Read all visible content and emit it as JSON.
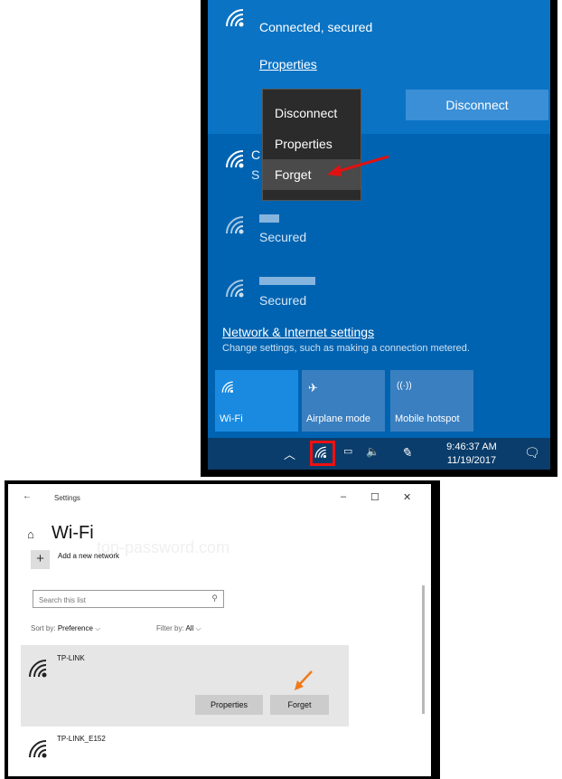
{
  "flyout": {
    "connected_status": "Connected, secured",
    "properties_link": "Properties",
    "disconnect_button": "Disconnect",
    "context_menu": [
      "Disconnect",
      "Properties",
      "Forget"
    ],
    "networks": [
      {
        "name_prefix": "C",
        "status_prefix": "S"
      },
      {
        "status": "Secured"
      },
      {
        "status": "Secured"
      }
    ],
    "network_settings_link": "Network & Internet settings",
    "network_settings_sub": "Change settings, such as making a connection metered.",
    "tiles": [
      {
        "label": "Wi-Fi",
        "icon": "wifi-icon",
        "active": true
      },
      {
        "label": "Airplane mode",
        "icon": "airplane-icon",
        "active": false
      },
      {
        "label": "Mobile hotspot",
        "icon": "hotspot-icon",
        "active": false
      }
    ],
    "taskbar": {
      "time": "9:46:37 AM",
      "date": "11/19/2017"
    },
    "colors": {
      "accent": "#0063b1",
      "highlight_box": "#e11111",
      "arrow": "#e11111"
    }
  },
  "settings": {
    "window_title": "Settings",
    "page_title": "Wi-Fi",
    "add_network": "Add a new network",
    "search_placeholder": "Search this list",
    "sort_label": "Sort by:",
    "sort_value": "Preference",
    "filter_label": "Filter by:",
    "filter_value": "All",
    "watermark": "top-password.com",
    "networks": [
      {
        "name": "TP-LINK",
        "buttons": [
          "Properties",
          "Forget"
        ]
      },
      {
        "name": "TP-LINK_E152"
      }
    ],
    "colors": {
      "arrow": "#f07a1a"
    }
  }
}
